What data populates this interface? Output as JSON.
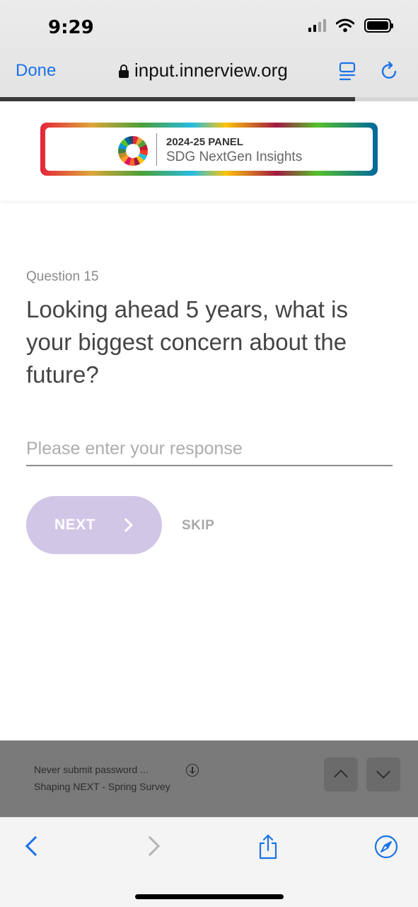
{
  "status_bar": {
    "time": "9:29"
  },
  "browser": {
    "done_label": "Done",
    "url": "input.innerview.org",
    "load_progress": 0.85
  },
  "banner": {
    "title": "2024-25 PANEL",
    "subtitle": "SDG NextGen Insights"
  },
  "question": {
    "number_label": "Question 15",
    "text": "Looking ahead 5 years, what is your biggest concern about the future?",
    "response_value": "",
    "response_placeholder": "Please enter your response",
    "next_label": "NEXT",
    "skip_label": "SKIP"
  },
  "accessory_bar": {
    "line1": "Never submit password  ...",
    "line2": "Shaping NEXT - Spring Survey"
  },
  "colors": {
    "accent_blue": "#1a73e8",
    "next_button": "#d2c6e7",
    "accessory_bg": "#7a7a7a"
  },
  "icons": [
    "lock-icon",
    "reader-icon",
    "reload-icon",
    "sdg-wheel-icon",
    "chevron-right-icon",
    "download-icon",
    "chevron-up-icon",
    "chevron-down-icon",
    "back-icon",
    "forward-icon",
    "share-icon",
    "compass-icon"
  ]
}
